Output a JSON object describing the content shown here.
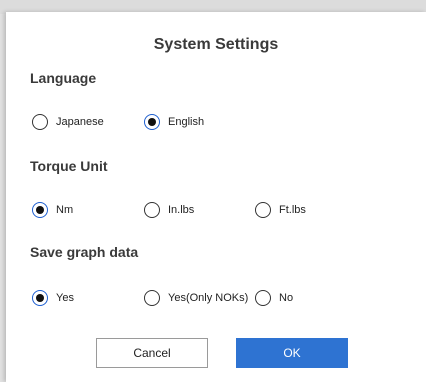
{
  "dialog": {
    "title": "System Settings",
    "language": {
      "heading": "Language",
      "options": [
        {
          "label": "Japanese",
          "selected": false
        },
        {
          "label": "English",
          "selected": true
        }
      ]
    },
    "torque_unit": {
      "heading": "Torque Unit",
      "options": [
        {
          "label": "Nm",
          "selected": true
        },
        {
          "label": "In.lbs",
          "selected": false
        },
        {
          "label": "Ft.lbs",
          "selected": false
        }
      ]
    },
    "save_graph": {
      "heading": "Save graph data",
      "options": [
        {
          "label": "Yes",
          "selected": true
        },
        {
          "label": "Yes(Only NOKs)",
          "selected": false
        },
        {
          "label": "No",
          "selected": false
        }
      ]
    },
    "buttons": {
      "cancel": "Cancel",
      "ok": "OK"
    }
  },
  "colors": {
    "accent": "#2e73d2",
    "selected_ring": "#1e5fd0"
  }
}
